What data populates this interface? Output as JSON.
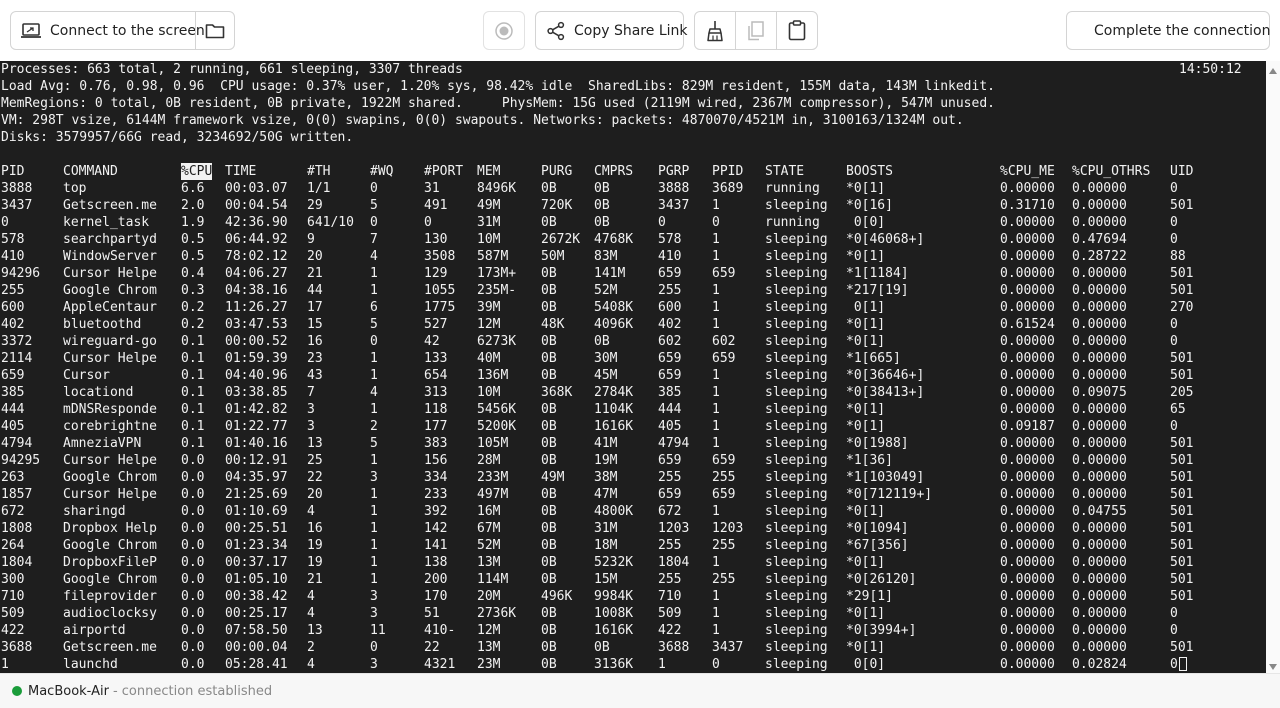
{
  "toolbar": {
    "connect_label": "Connect to the screen",
    "share_label": "Copy Share Link",
    "complete_label": "Complete the connection",
    "icons": {
      "connect": "laptop-icon",
      "folder": "folder-icon",
      "record": "record-icon",
      "share": "share-icon",
      "broom": "broom-icon",
      "copy": "copy-icon",
      "clipboard": "clipboard-icon",
      "stop": "stop-icon"
    }
  },
  "terminal": {
    "summary": [
      "Processes: 663 total, 2 running, 661 sleeping, 3307 threads",
      "Load Avg: 0.76, 0.98, 0.96  CPU usage: 0.37% user, 1.20% sys, 98.42% idle  SharedLibs: 829M resident, 155M data, 143M linkedit.",
      "MemRegions: 0 total, 0B resident, 0B private, 1922M shared.     PhysMem: 15G used (2119M wired, 2367M compressor), 547M unused.",
      "VM: 298T vsize, 6144M framework vsize, 0(0) swapins, 0(0) swapouts. Networks: packets: 4870070/4521M in, 3100163/1324M out.",
      "Disks: 3579957/66G read, 3234692/50G written."
    ],
    "clock": "14:50:12",
    "columns": [
      "PID",
      "COMMAND",
      "%CPU",
      "TIME",
      "#TH",
      "#WQ",
      "#PORT",
      "MEM",
      "PURG",
      "CMPRS",
      "PGRP",
      "PPID",
      "STATE",
      "BOOSTS",
      "%CPU_ME",
      "%CPU_OTHRS",
      "UID"
    ],
    "sort_column": "%CPU",
    "rows": [
      [
        "3888",
        "top",
        "6.6",
        "00:03.07",
        "1/1",
        "0",
        "31",
        "8496K",
        "0B",
        "0B",
        "3888",
        "3689",
        "running",
        "*0[1]",
        "0.00000",
        "0.00000",
        "0"
      ],
      [
        "3437",
        "Getscreen.me",
        "2.0",
        "00:04.54",
        "29",
        "5",
        "491",
        "49M",
        "720K",
        "0B",
        "3437",
        "1",
        "sleeping",
        "*0[16]",
        "0.31710",
        "0.00000",
        "501"
      ],
      [
        "0",
        "kernel_task",
        "1.9",
        "42:36.90",
        "641/10",
        "0",
        "0",
        "31M",
        "0B",
        "0B",
        "0",
        "0",
        "running",
        " 0[0]",
        "0.00000",
        "0.00000",
        "0"
      ],
      [
        "578",
        "searchpartyd",
        "0.5",
        "06:44.92",
        "9",
        "7",
        "130",
        "10M",
        "2672K",
        "4768K",
        "578",
        "1",
        "sleeping",
        "*0[46068+]",
        "0.00000",
        "0.47694",
        "0"
      ],
      [
        "410",
        "WindowServer",
        "0.5",
        "78:02.12",
        "20",
        "4",
        "3508",
        "587M",
        "50M",
        "83M",
        "410",
        "1",
        "sleeping",
        "*0[1]",
        "0.00000",
        "0.28722",
        "88"
      ],
      [
        "94296",
        "Cursor Helpe",
        "0.4",
        "04:06.27",
        "21",
        "1",
        "129",
        "173M+",
        "0B",
        "141M",
        "659",
        "659",
        "sleeping",
        "*1[1184]",
        "0.00000",
        "0.00000",
        "501"
      ],
      [
        "255",
        "Google Chrom",
        "0.3",
        "04:38.16",
        "44",
        "1",
        "1055",
        "235M-",
        "0B",
        "52M",
        "255",
        "1",
        "sleeping",
        "*217[19]",
        "0.00000",
        "0.00000",
        "501"
      ],
      [
        "600",
        "AppleCentaur",
        "0.2",
        "11:26.27",
        "17",
        "6",
        "1775",
        "39M",
        "0B",
        "5408K",
        "600",
        "1",
        "sleeping",
        " 0[1]",
        "0.00000",
        "0.00000",
        "270"
      ],
      [
        "402",
        "bluetoothd",
        "0.2",
        "03:47.53",
        "15",
        "5",
        "527",
        "12M",
        "48K",
        "4096K",
        "402",
        "1",
        "sleeping",
        "*0[1]",
        "0.61524",
        "0.00000",
        "0"
      ],
      [
        "3372",
        "wireguard-go",
        "0.1",
        "00:00.52",
        "16",
        "0",
        "42",
        "6273K",
        "0B",
        "0B",
        "602",
        "602",
        "sleeping",
        "*0[1]",
        "0.00000",
        "0.00000",
        "0"
      ],
      [
        "2114",
        "Cursor Helpe",
        "0.1",
        "01:59.39",
        "23",
        "1",
        "133",
        "40M",
        "0B",
        "30M",
        "659",
        "659",
        "sleeping",
        "*1[665]",
        "0.00000",
        "0.00000",
        "501"
      ],
      [
        "659",
        "Cursor",
        "0.1",
        "04:40.96",
        "43",
        "1",
        "654",
        "136M",
        "0B",
        "45M",
        "659",
        "1",
        "sleeping",
        "*0[36646+]",
        "0.00000",
        "0.00000",
        "501"
      ],
      [
        "385",
        "locationd",
        "0.1",
        "03:38.85",
        "7",
        "4",
        "313",
        "10M",
        "368K",
        "2784K",
        "385",
        "1",
        "sleeping",
        "*0[38413+]",
        "0.00000",
        "0.09075",
        "205"
      ],
      [
        "444",
        "mDNSResponde",
        "0.1",
        "01:42.82",
        "3",
        "1",
        "118",
        "5456K",
        "0B",
        "1104K",
        "444",
        "1",
        "sleeping",
        "*0[1]",
        "0.00000",
        "0.00000",
        "65"
      ],
      [
        "405",
        "corebrightne",
        "0.1",
        "01:22.77",
        "3",
        "2",
        "177",
        "5200K",
        "0B",
        "1616K",
        "405",
        "1",
        "sleeping",
        "*0[1]",
        "0.09187",
        "0.00000",
        "0"
      ],
      [
        "4794",
        "AmneziaVPN",
        "0.1",
        "01:40.16",
        "13",
        "5",
        "383",
        "105M",
        "0B",
        "41M",
        "4794",
        "1",
        "sleeping",
        "*0[1988]",
        "0.00000",
        "0.00000",
        "501"
      ],
      [
        "94295",
        "Cursor Helpe",
        "0.0",
        "00:12.91",
        "25",
        "1",
        "156",
        "28M",
        "0B",
        "19M",
        "659",
        "659",
        "sleeping",
        "*1[36]",
        "0.00000",
        "0.00000",
        "501"
      ],
      [
        "263",
        "Google Chrom",
        "0.0",
        "04:35.97",
        "22",
        "3",
        "334",
        "233M",
        "49M",
        "38M",
        "255",
        "255",
        "sleeping",
        "*1[103049]",
        "0.00000",
        "0.00000",
        "501"
      ],
      [
        "1857",
        "Cursor Helpe",
        "0.0",
        "21:25.69",
        "20",
        "1",
        "233",
        "497M",
        "0B",
        "47M",
        "659",
        "659",
        "sleeping",
        "*0[712119+]",
        "0.00000",
        "0.00000",
        "501"
      ],
      [
        "672",
        "sharingd",
        "0.0",
        "01:10.69",
        "4",
        "1",
        "392",
        "16M",
        "0B",
        "4800K",
        "672",
        "1",
        "sleeping",
        "*0[1]",
        "0.00000",
        "0.04755",
        "501"
      ],
      [
        "1808",
        "Dropbox Help",
        "0.0",
        "00:25.51",
        "16",
        "1",
        "142",
        "67M",
        "0B",
        "31M",
        "1203",
        "1203",
        "sleeping",
        "*0[1094]",
        "0.00000",
        "0.00000",
        "501"
      ],
      [
        "264",
        "Google Chrom",
        "0.0",
        "01:23.34",
        "19",
        "1",
        "141",
        "52M",
        "0B",
        "18M",
        "255",
        "255",
        "sleeping",
        "*67[356]",
        "0.00000",
        "0.00000",
        "501"
      ],
      [
        "1804",
        "DropboxFileP",
        "0.0",
        "00:37.17",
        "19",
        "1",
        "138",
        "13M",
        "0B",
        "5232K",
        "1804",
        "1",
        "sleeping",
        "*0[1]",
        "0.00000",
        "0.00000",
        "501"
      ],
      [
        "300",
        "Google Chrom",
        "0.0",
        "01:05.10",
        "21",
        "1",
        "200",
        "114M",
        "0B",
        "15M",
        "255",
        "255",
        "sleeping",
        "*0[26120]",
        "0.00000",
        "0.00000",
        "501"
      ],
      [
        "710",
        "fileprovider",
        "0.0",
        "00:38.42",
        "4",
        "3",
        "170",
        "20M",
        "496K",
        "9984K",
        "710",
        "1",
        "sleeping",
        "*29[1]",
        "0.00000",
        "0.00000",
        "501"
      ],
      [
        "509",
        "audioclocksy",
        "0.0",
        "00:25.17",
        "4",
        "3",
        "51",
        "2736K",
        "0B",
        "1008K",
        "509",
        "1",
        "sleeping",
        "*0[1]",
        "0.00000",
        "0.00000",
        "0"
      ],
      [
        "422",
        "airportd",
        "0.0",
        "07:58.50",
        "13",
        "11",
        "410-",
        "12M",
        "0B",
        "1616K",
        "422",
        "1",
        "sleeping",
        "*0[3994+]",
        "0.00000",
        "0.00000",
        "0"
      ],
      [
        "3688",
        "Getscreen.me",
        "0.0",
        "00:00.04",
        "2",
        "0",
        "22",
        "13M",
        "0B",
        "0B",
        "3688",
        "3437",
        "sleeping",
        "*0[1]",
        "0.00000",
        "0.00000",
        "501"
      ],
      [
        "1",
        "launchd",
        "0.0",
        "05:28.41",
        "4",
        "3",
        "4321",
        "23M",
        "0B",
        "3136K",
        "1",
        "0",
        "sleeping",
        " 0[0]",
        "0.00000",
        "0.02824",
        "0"
      ]
    ]
  },
  "status": {
    "device": "MacBook-Air",
    "state": "- connection established",
    "indicator_color": "#1a9c3a"
  },
  "colors": {
    "terminal_bg": "#1e1e1e",
    "terminal_fg": "#f2f2f2"
  }
}
